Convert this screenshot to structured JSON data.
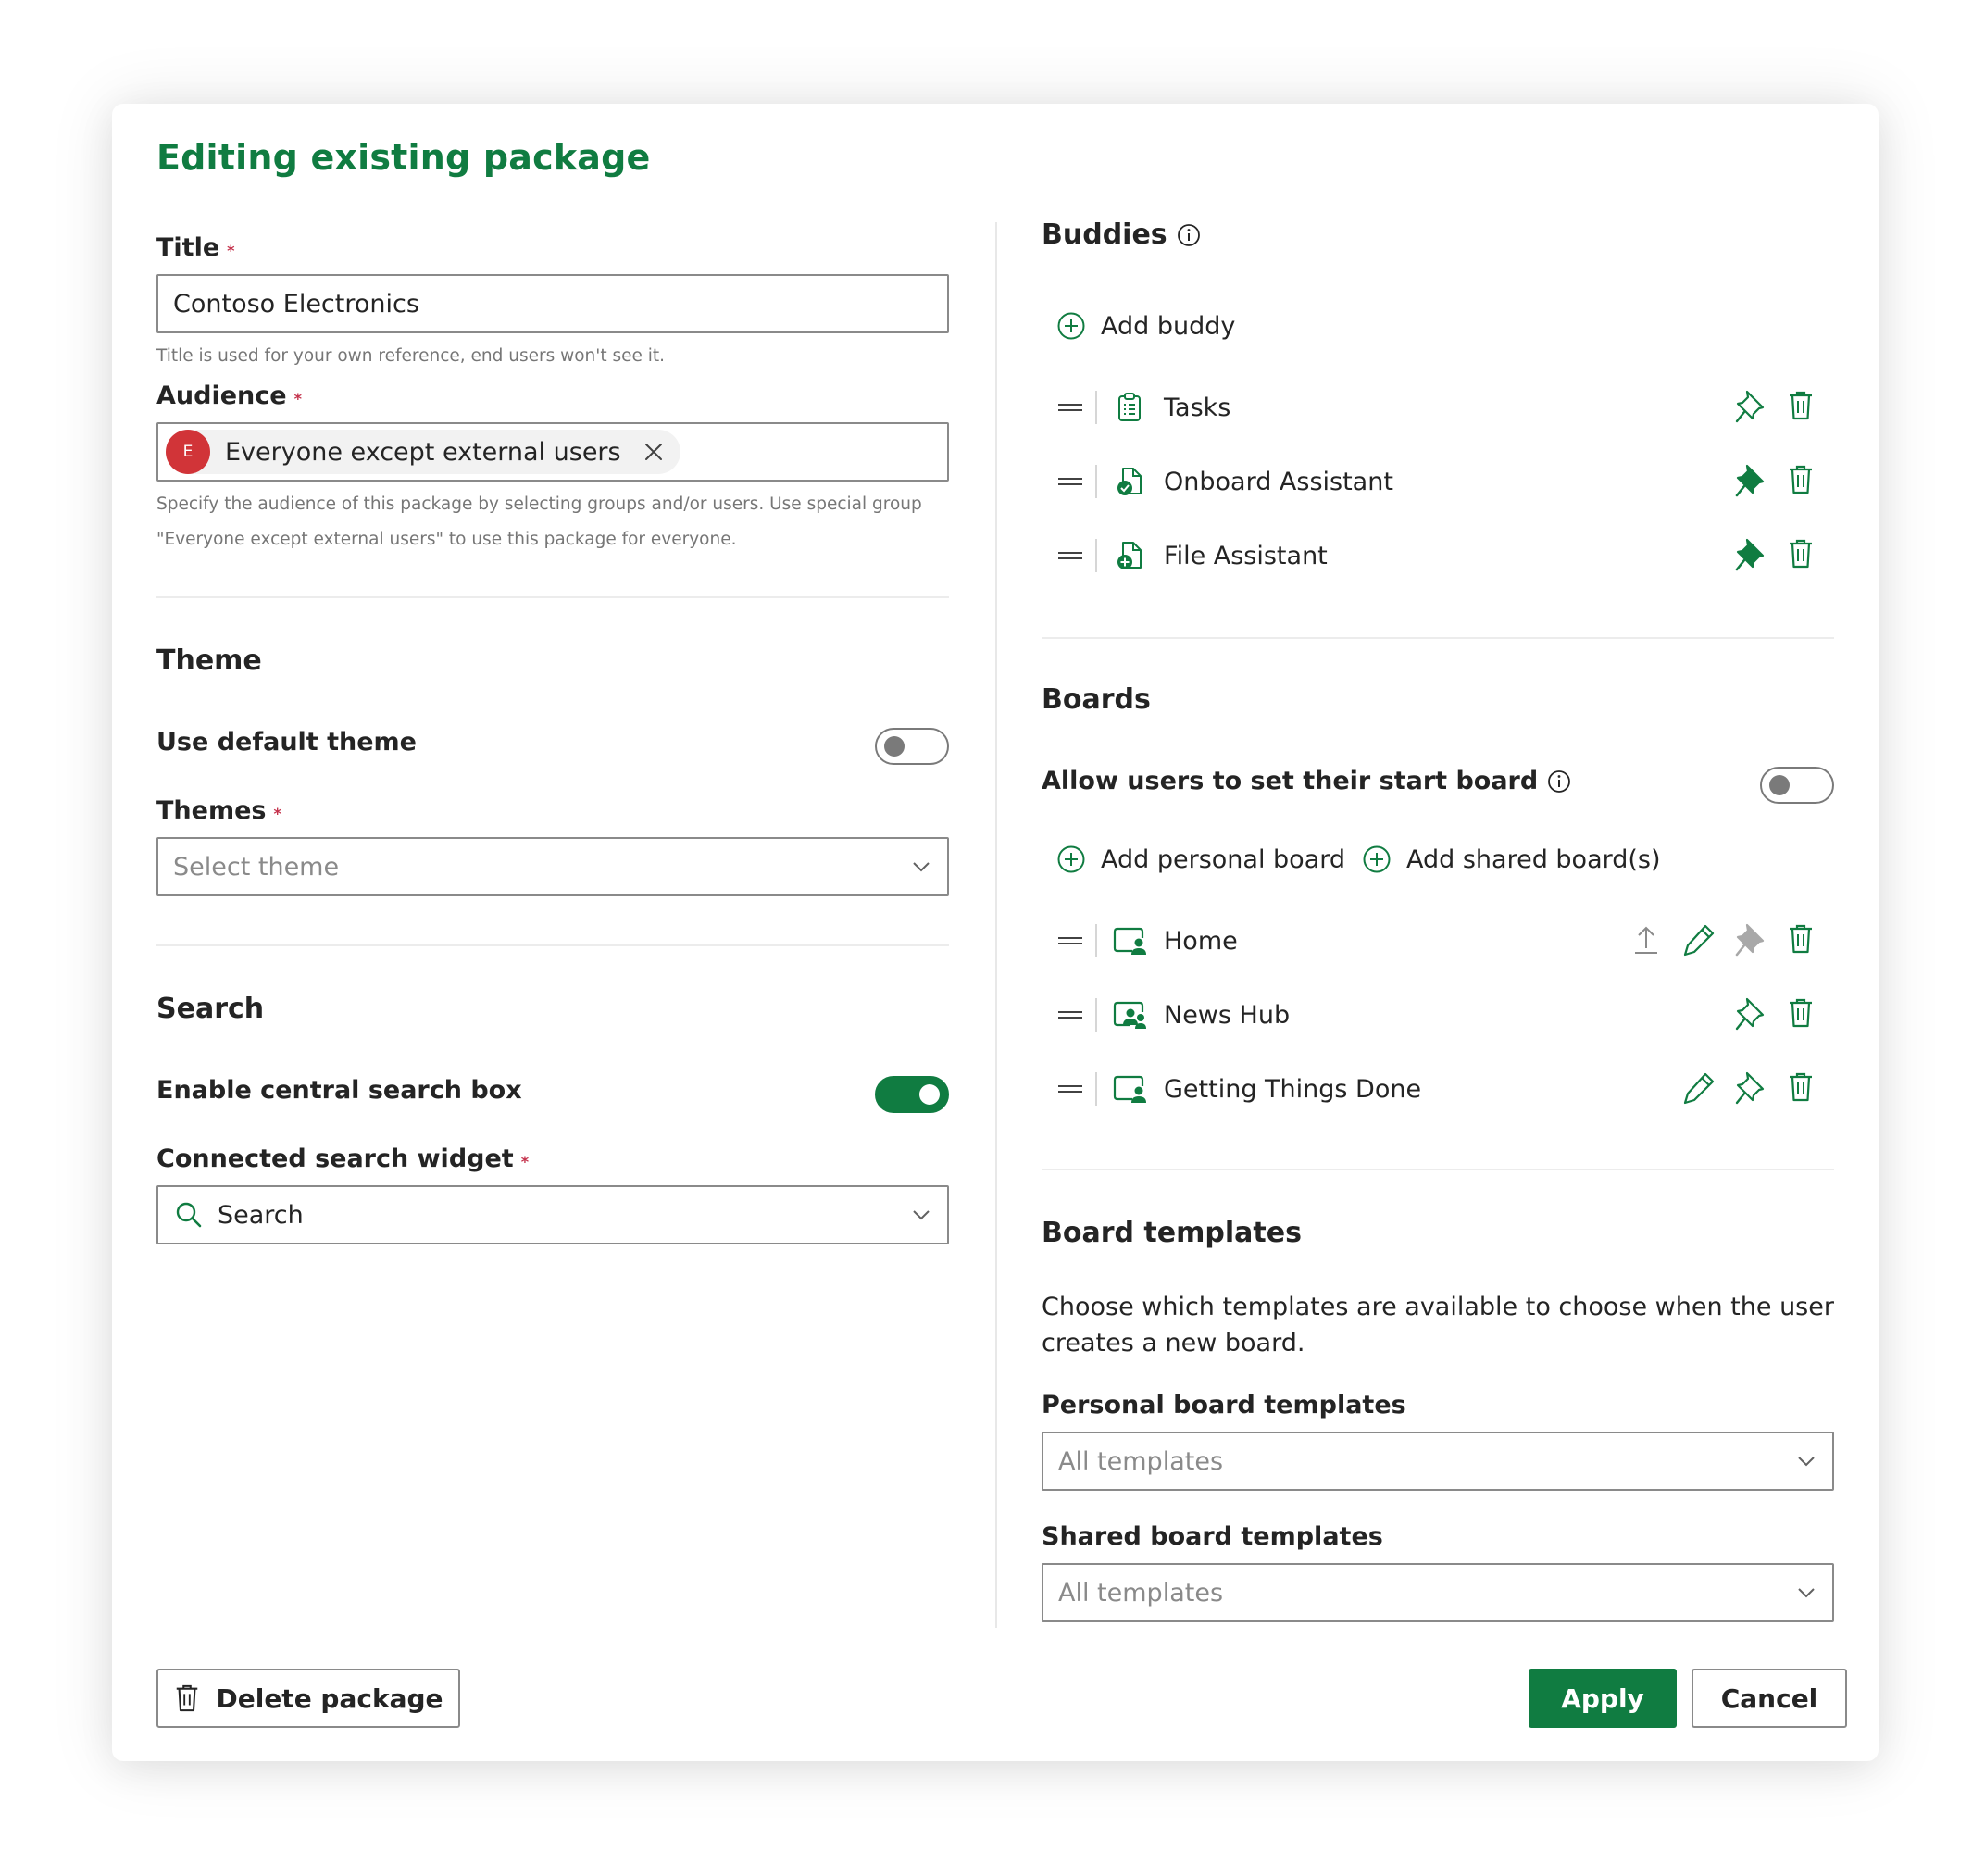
{
  "dialog": {
    "title": "Editing existing package"
  },
  "colors": {
    "accent": "#107c41",
    "required": "#c4314b",
    "avatar": "#d13438"
  },
  "general": {
    "title_label": "Title",
    "title_value": "Contoso Electronics",
    "title_helper": "Title is used for your own reference, end users won't see it.",
    "audience_label": "Audience",
    "audience_chip_initial": "E",
    "audience_chip_text": "Everyone except external users",
    "audience_helper_line1": "Specify the audience of this package by selecting groups and/or users. Use special group",
    "audience_helper_line2": "\"Everyone except external users\" to use this package for everyone.",
    "required_mark": "*"
  },
  "theme": {
    "section_title": "Theme",
    "use_default_label": "Use default theme",
    "use_default_on": false,
    "themes_label": "Themes",
    "themes_placeholder": "Select theme"
  },
  "search": {
    "section_title": "Search",
    "enable_label": "Enable central search box",
    "enable_on": true,
    "widget_label": "Connected search widget",
    "widget_value": "Search"
  },
  "buddies": {
    "section_title": "Buddies",
    "add_label": "Add buddy",
    "items": [
      {
        "name": "Tasks",
        "icon": "clipboard-icon",
        "pinned": false
      },
      {
        "name": "Onboard Assistant",
        "icon": "document-check-icon",
        "pinned": true
      },
      {
        "name": "File Assistant",
        "icon": "document-add-icon",
        "pinned": true
      }
    ]
  },
  "boards": {
    "section_title": "Boards",
    "allow_start_label": "Allow users to set their start board",
    "allow_start_on": false,
    "add_personal_label": "Add personal board",
    "add_shared_label": "Add shared board(s)",
    "items": [
      {
        "name": "Home",
        "icon": "board-person-icon",
        "actions": [
          "upload",
          "edit",
          "pin-disabled",
          "delete"
        ]
      },
      {
        "name": "News Hub",
        "icon": "board-people-icon",
        "actions": [
          "pin",
          "delete"
        ]
      },
      {
        "name": "Getting Things Done",
        "icon": "board-person-icon",
        "actions": [
          "edit",
          "pin",
          "delete"
        ]
      }
    ]
  },
  "templates": {
    "section_title": "Board templates",
    "description_line1": "Choose which templates are available to choose when the user",
    "description_line2": "creates a new board.",
    "personal_label": "Personal board templates",
    "personal_value": "All templates",
    "shared_label": "Shared board templates",
    "shared_value": "All templates"
  },
  "footer": {
    "delete_label": "Delete package",
    "apply_label": "Apply",
    "cancel_label": "Cancel"
  }
}
